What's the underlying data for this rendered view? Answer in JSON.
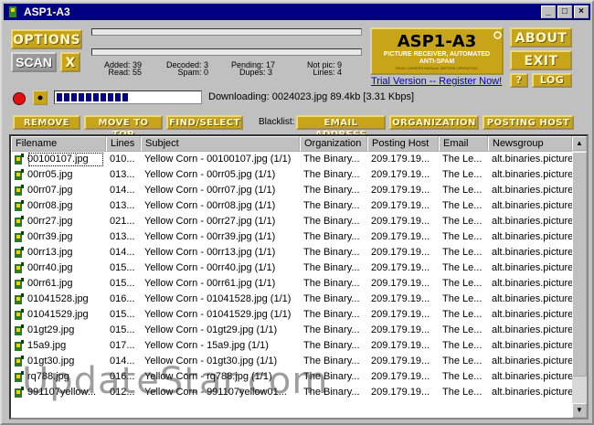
{
  "title": "ASP1-A3",
  "buttons": {
    "options": "OPTIONS",
    "scan": "SCAN",
    "x": "X",
    "about": "ABOUT",
    "exit": "EXIT",
    "help": "?",
    "log": "LOG",
    "remove": "REMOVE",
    "move_to_top": "MOVE TO TOP",
    "find_select": "FIND/SELECT",
    "email_address": "EMAIL ADDRESS",
    "organization": "ORGANIZATION",
    "posting_host": "POSTING HOST"
  },
  "blacklist_label": "Blacklist:",
  "stats": {
    "added": "Added: 39",
    "read": "Read: 55",
    "decoded": "Decoded: 3",
    "spam": "Spam: 0",
    "pending": "Pending: 17",
    "dupes": "Dupes: 3",
    "notpic": "Not pic: 9",
    "lines": "Lines: 4"
  },
  "logo": {
    "title": "ASP1-A3",
    "line1": "PICTURE RECEIVER, AUTOMATED",
    "line2": "ANTI-SPAM",
    "line3": "READ OWNERS MANUAL BEFORE OPERATING"
  },
  "trial_link": "Trial Version -- Register Now!",
  "downloading": "Downloading: 0024023.jpg 89.4kb [3.31 Kbps]",
  "progress": 0.55,
  "columns": [
    "Filename",
    "Lines",
    "Subject",
    "Organization",
    "Posting Host",
    "Email",
    "Newsgroup"
  ],
  "rows": [
    [
      "00100107.jpg",
      "010...",
      "Yellow Corn - 00100107.jpg (1/1)",
      "The Binary...",
      "209.179.19...",
      "The Le...",
      "alt.binaries.pictures"
    ],
    [
      "00rr05.jpg",
      "013...",
      "Yellow Corn - 00rr05.jpg (1/1)",
      "The Binary...",
      "209.179.19...",
      "The Le...",
      "alt.binaries.pictures"
    ],
    [
      "00rr07.jpg",
      "014...",
      "Yellow Corn - 00rr07.jpg (1/1)",
      "The Binary...",
      "209.179.19...",
      "The Le...",
      "alt.binaries.pictures"
    ],
    [
      "00rr08.jpg",
      "013...",
      "Yellow Corn - 00rr08.jpg (1/1)",
      "The Binary...",
      "209.179.19...",
      "The Le...",
      "alt.binaries.pictures"
    ],
    [
      "00rr27.jpg",
      "021...",
      "Yellow Corn - 00rr27.jpg (1/1)",
      "The Binary...",
      "209.179.19...",
      "The Le...",
      "alt.binaries.pictures"
    ],
    [
      "00rr39.jpg",
      "013...",
      "Yellow Corn - 00rr39.jpg (1/1)",
      "The Binary...",
      "209.179.19...",
      "The Le...",
      "alt.binaries.pictures"
    ],
    [
      "00rr13.jpg",
      "014...",
      "Yellow Corn - 00rr13.jpg (1/1)",
      "The Binary...",
      "209.179.19...",
      "The Le...",
      "alt.binaries.pictures"
    ],
    [
      "00rr40.jpg",
      "015...",
      "Yellow Corn - 00rr40.jpg (1/1)",
      "The Binary...",
      "209.179.19...",
      "The Le...",
      "alt.binaries.pictures"
    ],
    [
      "00rr61.jpg",
      "015...",
      "Yellow Corn - 00rr61.jpg (1/1)",
      "The Binary...",
      "209.179.19...",
      "The Le...",
      "alt.binaries.pictures"
    ],
    [
      "01041528.jpg",
      "016...",
      "Yellow Corn - 01041528.jpg (1/1)",
      "The Binary...",
      "209.179.19...",
      "The Le...",
      "alt.binaries.pictures"
    ],
    [
      "01041529.jpg",
      "015...",
      "Yellow Corn - 01041529.jpg (1/1)",
      "The Binary...",
      "209.179.19...",
      "The Le...",
      "alt.binaries.pictures"
    ],
    [
      "01gt29.jpg",
      "015...",
      "Yellow Corn - 01gt29.jpg (1/1)",
      "The Binary...",
      "209.179.19...",
      "The Le...",
      "alt.binaries.pictures"
    ],
    [
      "15a9.jpg",
      "017...",
      "Yellow Corn - 15a9.jpg (1/1)",
      "The Binary...",
      "209.179.19...",
      "The Le...",
      "alt.binaries.pictures"
    ],
    [
      "01gt30.jpg",
      "014...",
      "Yellow Corn - 01gt30.jpg (1/1)",
      "The Binary...",
      "209.179.19...",
      "The Le...",
      "alt.binaries.pictures"
    ],
    [
      "rq788.jpg",
      "016...",
      "Yellow Corn - rq788.jpg (1/1)",
      "The Binary...",
      "209.179.19...",
      "The Le...",
      "alt.binaries.pictures"
    ],
    [
      "991107yellow...",
      "012...",
      "Yellow Corn - 991107yellow01...",
      "The Binary...",
      "209.179.19...",
      "The Le...",
      "alt.binaries.pictures"
    ]
  ],
  "watermark": "UpdateStar.com"
}
